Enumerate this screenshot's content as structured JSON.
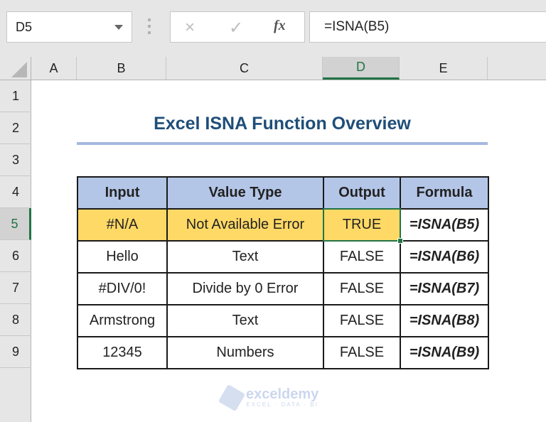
{
  "formula_bar": {
    "name_box": "D5",
    "cancel_icon": "×",
    "enter_icon": "✓",
    "fx_label": "fx",
    "formula": "=ISNA(B5)"
  },
  "columns": [
    "A",
    "B",
    "C",
    "D",
    "E"
  ],
  "active_column": "D",
  "rows": [
    "1",
    "2",
    "3",
    "4",
    "5",
    "6",
    "7",
    "8",
    "9"
  ],
  "active_row": "5",
  "sheet": {
    "title": "Excel ISNA Function Overview",
    "headers": [
      "Input",
      "Value Type",
      "Output",
      "Formula"
    ],
    "rows": [
      {
        "input": "#N/A",
        "type": "Not Available Error",
        "output": "TRUE",
        "formula": "=ISNA(B5)"
      },
      {
        "input": "Hello",
        "type": "Text",
        "output": "FALSE",
        "formula": "=ISNA(B6)"
      },
      {
        "input": "#DIV/0!",
        "type": "Divide by 0 Error",
        "output": "FALSE",
        "formula": "=ISNA(B7)"
      },
      {
        "input": "Armstrong",
        "type": "Text",
        "output": "FALSE",
        "formula": "=ISNA(B8)"
      },
      {
        "input": "12345",
        "type": "Numbers",
        "output": "FALSE",
        "formula": "=ISNA(B9)"
      }
    ]
  },
  "watermark": {
    "name": "exceldemy",
    "tagline": "EXCEL · DATA · BI"
  },
  "colors": {
    "header_fill": "#b4c6e7",
    "highlight_fill": "#ffd966",
    "selection": "#217346",
    "title": "#1f4e79",
    "formula_text": "#4a90d9"
  }
}
